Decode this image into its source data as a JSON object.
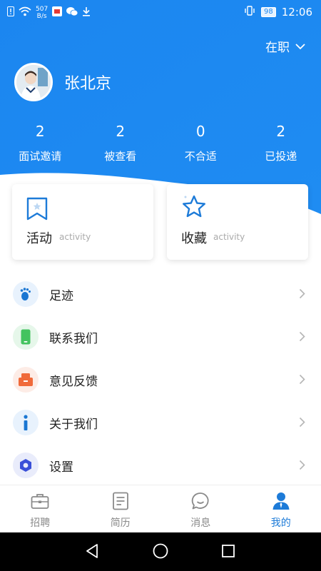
{
  "status_bar": {
    "net_speed_value": "507",
    "net_speed_unit": "B/s",
    "battery": "98",
    "time": "12:06"
  },
  "header": {
    "job_status": "在职",
    "username": "张北京",
    "stats": [
      {
        "value": "2",
        "label": "面试邀请"
      },
      {
        "value": "2",
        "label": "被查看"
      },
      {
        "value": "0",
        "label": "不合适"
      },
      {
        "value": "2",
        "label": "已投递"
      }
    ]
  },
  "cards": [
    {
      "title": "活动",
      "subtitle": "activity",
      "icon": "bookmark-icon"
    },
    {
      "title": "收藏",
      "subtitle": "activity",
      "icon": "star-icon"
    }
  ],
  "menu": [
    {
      "label": "足迹",
      "icon": "footprint-icon",
      "color": "#1976d2",
      "bg": "#e8f2fd"
    },
    {
      "label": "联系我们",
      "icon": "phone-icon",
      "color": "#43c35f",
      "bg": "#e6f7ea"
    },
    {
      "label": "意见反馈",
      "icon": "feedback-icon",
      "color": "#f06a3a",
      "bg": "#fdece6"
    },
    {
      "label": "关于我们",
      "icon": "info-icon",
      "color": "#1976d2",
      "bg": "#e8f2fd"
    },
    {
      "label": "设置",
      "icon": "settings-icon",
      "color": "#3a4fd8",
      "bg": "#e9ecfb"
    }
  ],
  "tabs": [
    {
      "label": "招聘",
      "icon": "briefcase-icon",
      "active": false
    },
    {
      "label": "简历",
      "icon": "resume-icon",
      "active": false
    },
    {
      "label": "消息",
      "icon": "message-icon",
      "active": false
    },
    {
      "label": "我的",
      "icon": "profile-icon",
      "active": true
    }
  ],
  "colors": {
    "header_blue": "#1e88f0",
    "accent": "#1d7bd8",
    "tab_inactive": "#8a8a8a"
  }
}
